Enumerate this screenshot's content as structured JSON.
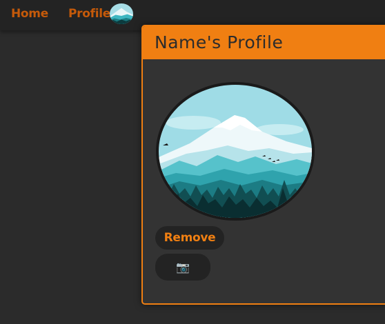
{
  "nav": {
    "home_label": "Home",
    "profile_label": "Profile",
    "avatar_icon": "mountain-landscape-avatar"
  },
  "profile_card": {
    "title": "Name's Profile",
    "image_icon": "mountain-landscape-picture",
    "remove_label": "Remove",
    "camera_label": "📷"
  },
  "colors": {
    "accent": "#f07f12",
    "nav_link": "#c55a0a",
    "background": "#2b2b2b",
    "card_bg": "#333333",
    "button_bg": "#232323"
  }
}
